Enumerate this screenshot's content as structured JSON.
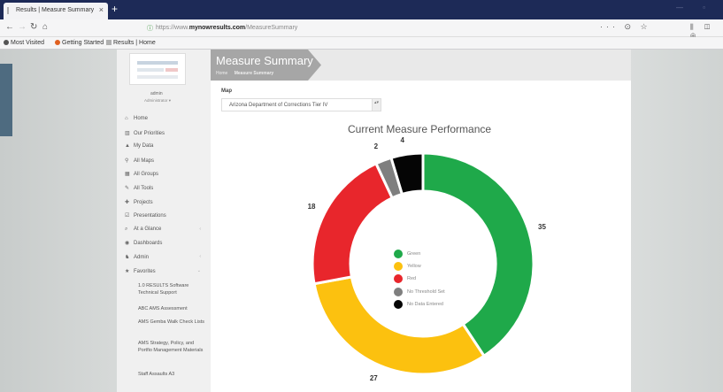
{
  "browser": {
    "tab_title": "Results | Measure Summary",
    "tab_close": "×",
    "new_tab": "+",
    "url_prefix": "https://www.",
    "url_domain": "mynowresults.com",
    "url_path": "/MeasureSummary",
    "url_actions": "··· ⊙ ☆",
    "right_icons": "⫼ ◫ ⊕",
    "window_buttons": "— ▫",
    "bookmarks": [
      {
        "label": "Most Visited",
        "color": "#555555"
      },
      {
        "label": "Getting Started",
        "color": "#e06020"
      },
      {
        "label": "Results | Home",
        "color": "#b0b0b0"
      }
    ]
  },
  "sidebar": {
    "username": "admin",
    "role": "Administrator ▾",
    "items": [
      {
        "icon": "home-icon",
        "glyph": "⌂",
        "label": "Home",
        "caret": ""
      },
      {
        "icon": "chart-icon",
        "glyph": "▥",
        "label": "Our Priorities",
        "caret": ""
      },
      {
        "icon": "user-icon",
        "glyph": "▲",
        "label": "My Data",
        "caret": ""
      },
      {
        "icon": "pin-icon",
        "glyph": "⚲",
        "label": "All Maps",
        "caret": ""
      },
      {
        "icon": "group-icon",
        "glyph": "▦",
        "label": "All Groups",
        "caret": ""
      },
      {
        "icon": "wrench-icon",
        "glyph": "✎",
        "label": "All Tools",
        "caret": ""
      },
      {
        "icon": "projects-icon",
        "glyph": "✚",
        "label": "Projects",
        "caret": ""
      },
      {
        "icon": "presentation-icon",
        "glyph": "☑",
        "label": "Presentations",
        "caret": ""
      },
      {
        "icon": "search-icon",
        "glyph": "⌕",
        "label": "At a Glance",
        "caret": "‹"
      },
      {
        "icon": "dashboard-icon",
        "glyph": "◉",
        "label": "Dashboards",
        "caret": ""
      },
      {
        "icon": "admin-icon",
        "glyph": "♞",
        "label": "Admin",
        "caret": "‹"
      },
      {
        "icon": "star-icon",
        "glyph": "★",
        "label": "Favorites",
        "caret": "⌄"
      }
    ],
    "favorites": [
      "1.0 RESULTS Software Technical Support",
      "ABC AMS Assessment",
      "AMS Gemba Walk Check Lists",
      "AMS Strategy, Policy, and Portfio Management Materials",
      "Staff Assaults A3"
    ]
  },
  "header": {
    "title": "Measure Summary",
    "breadcrumb_home": "Home",
    "breadcrumb_current": "Measure Summary"
  },
  "map": {
    "label": "Map",
    "selected": "Arizona Department of Corrections Tier IV",
    "arrow": "▴▾"
  },
  "chart_data": {
    "type": "pie",
    "title": "Current Measure Performance",
    "donut": true,
    "slices": [
      {
        "label": "Green",
        "value": 35,
        "color": "#1fa94a"
      },
      {
        "label": "Yellow",
        "value": 27,
        "color": "#fcc10f"
      },
      {
        "label": "Red",
        "value": 18,
        "color": "#e8262c"
      },
      {
        "label": "No Threshold Set",
        "value": 2,
        "color": "#7f7f7f"
      },
      {
        "label": "No Data Entered",
        "value": 4,
        "color": "#050505"
      }
    ],
    "legend_position": "center"
  }
}
